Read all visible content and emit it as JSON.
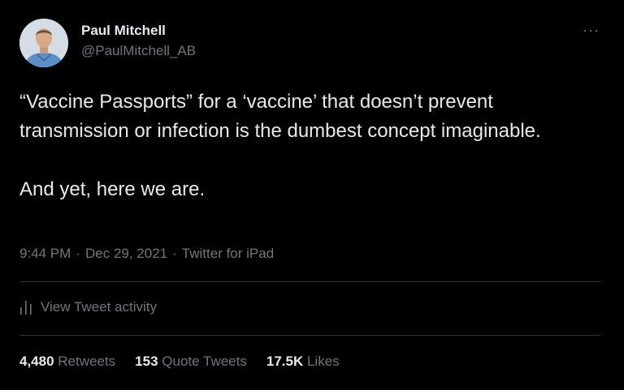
{
  "author": {
    "name": "Paul Mitchell",
    "handle": "@PaulMitchell_AB"
  },
  "more_label": "···",
  "tweet": {
    "paragraphs": [
      "“Vaccine Passports” for a ‘vaccine’ that doesn’t prevent transmission or infection is the dumbest concept imaginable.",
      "And yet, here we are."
    ],
    "time": "9:44 PM",
    "date": "Dec 29, 2021",
    "source": "Twitter for iPad",
    "separator": "·"
  },
  "activity_label": "View Tweet activity",
  "stats": {
    "retweets_count": "4,480",
    "retweets_label": "Retweets",
    "quotes_count": "153",
    "quotes_label": "Quote Tweets",
    "likes_count": "17.5K",
    "likes_label": "Likes"
  },
  "colors": {
    "background": "#000000",
    "primary_text": "#e7e9ea",
    "secondary_text": "#71767b",
    "divider": "#2f3336"
  }
}
